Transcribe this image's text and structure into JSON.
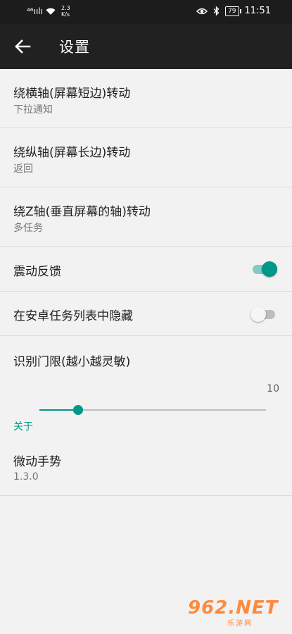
{
  "status_bar": {
    "signal": "⁴⁶ıılı",
    "speed": "2.3",
    "speed_unit": "K/s",
    "battery": "79",
    "time": "11:51"
  },
  "toolbar": {
    "title": "设置",
    "back_icon": "arrow-back"
  },
  "settings": {
    "rotate_x": {
      "title": "绕横轴(屏幕短边)转动",
      "value": "下拉通知"
    },
    "rotate_y": {
      "title": "绕纵轴(屏幕长边)转动",
      "value": "返回"
    },
    "rotate_z": {
      "title": "绕Z轴(垂直屏幕的轴)转动",
      "value": "多任务"
    },
    "vibration": {
      "title": "震动反馈",
      "enabled": true
    },
    "hide_recents": {
      "title": "在安卓任务列表中隐藏",
      "enabled": false
    },
    "threshold": {
      "title": "识别门限(越小越灵敏)",
      "value_label": "10",
      "fill_fraction": 0.17
    }
  },
  "about": {
    "header": "关于",
    "app_name": "微动手势",
    "version": "1.3.0"
  },
  "watermark": {
    "text": "962.NET",
    "sub": "乐游网"
  },
  "colors": {
    "accent": "#009688",
    "toolbar": "#212121",
    "background": "#f2f2f2"
  }
}
